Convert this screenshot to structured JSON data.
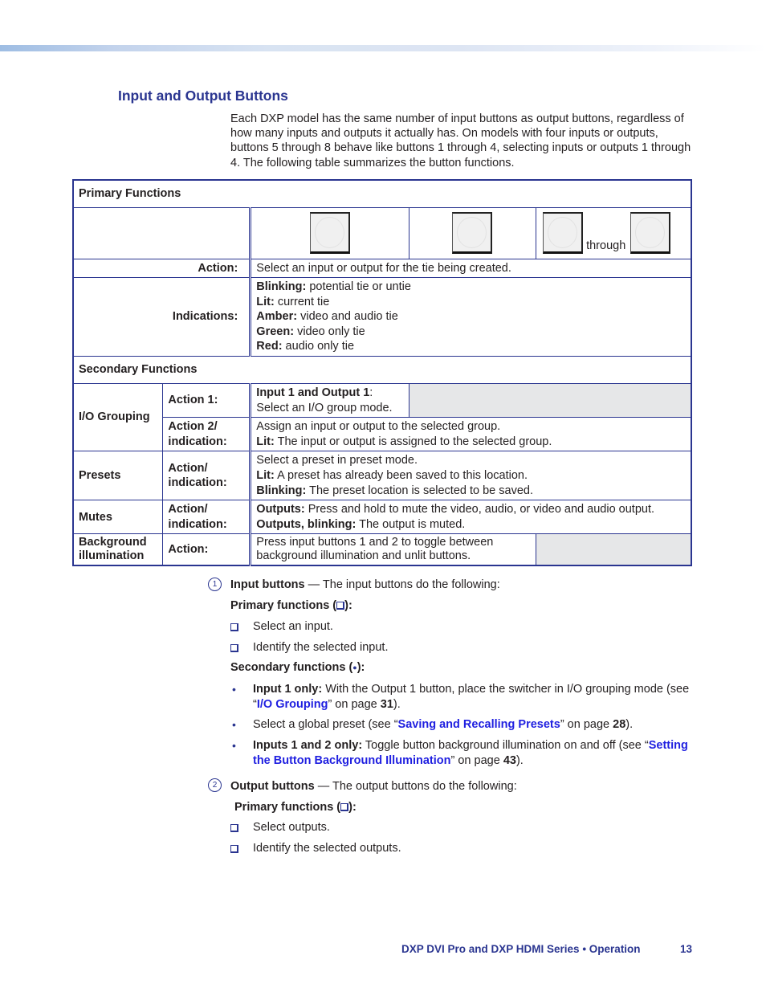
{
  "page": {
    "section_title": "Input and Output Buttons",
    "intro": "Each DXP model has the same number of input buttons as output buttons, regardless of how many inputs and outputs it actually has. On models with four inputs or outputs, buttons 5 through 8 behave like buttons 1 through 4, selecting inputs or outputs 1 through 4. The following table summarizes the button functions."
  },
  "table": {
    "primary_header": "Primary Functions",
    "through_label": "through",
    "action_label": "Action:",
    "action_text": "Select an input or output for the tie being created.",
    "indications_label": "Indications:",
    "indications": [
      {
        "term": "Blinking:",
        "desc": " potential tie or untie"
      },
      {
        "term": "Lit:",
        "desc": " current tie"
      },
      {
        "term": "Amber:",
        "desc": " video and audio tie"
      },
      {
        "term": "Green:",
        "desc": " video only tie"
      },
      {
        "term": "Red:",
        "desc": " audio only tie"
      }
    ],
    "secondary_header": "Secondary Functions",
    "io_grouping": {
      "label": "I/O Grouping",
      "action1_label": "Action 1:",
      "action1_term": "Input 1 and Output 1",
      "action1_colon": ":",
      "action1_desc": "Select an I/O group mode.",
      "action2_label_1": "Action 2/",
      "action2_label_2": "indication:",
      "action2_line1": "Assign an input or output to the selected group.",
      "action2_term": "Lit:",
      "action2_desc": " The input or output is assigned to the selected group."
    },
    "presets": {
      "label": "Presets",
      "action_label_1": "Action/",
      "action_label_2": "indication:",
      "line1": "Select a preset in preset mode.",
      "term2": "Lit:",
      "desc2": " A preset has already been saved to this location.",
      "term3": "Blinking:",
      "desc3": " The preset location is selected to be saved."
    },
    "mutes": {
      "label": "Mutes",
      "action_label_1": "Action/",
      "action_label_2": "indication:",
      "term1": "Outputs:",
      "desc1": " Press and hold to mute the video, audio, or video and audio output.",
      "term2": "Outputs, blinking:",
      "desc2": " The output is muted."
    },
    "background": {
      "label_1": "Background",
      "label_2": "illumination",
      "action_label": "Action:",
      "line1": "Press input buttons 1 and 2 to toggle between",
      "line2": "background illumination and unlit buttons."
    }
  },
  "input_section": {
    "callout": "1",
    "title": "Input buttons",
    "title_rest": " — The input buttons do the following:",
    "primary_label": "Primary functions (",
    "primary_label_end": "):",
    "primary_items": [
      "Select an input.",
      "Identify the selected input."
    ],
    "secondary_label": "Secondary functions (",
    "secondary_glyph": "●",
    "secondary_label_end": "):",
    "bullets": [
      {
        "lead": "Input 1 only:",
        "text": " With the Output 1 button, place the switcher in I/O grouping  mode (see “",
        "link": "I/O Grouping",
        "after": "” on page ",
        "page": "31",
        "end": ")."
      },
      {
        "lead": "",
        "text": "Select a global preset (see “",
        "link": "Saving and Recalling Presets",
        "after": "” on page ",
        "page": "28",
        "end": ")."
      },
      {
        "lead": "Inputs 1 and 2 only:",
        "text": " Toggle button background illumination on and off (see “",
        "link": "Setting the Button Background Illumination",
        "after": "” on page ",
        "page": "43",
        "end": ")."
      }
    ]
  },
  "output_section": {
    "callout": "2",
    "title": "Output buttons",
    "title_rest": " — The output buttons do the following:",
    "primary_label": "Primary functions (",
    "primary_label_end": "):",
    "primary_items": [
      "Select outputs.",
      "Identify the selected outputs."
    ]
  },
  "footer": {
    "title": "DXP DVI Pro and DXP HDMI Series • Operation",
    "page_number": "13"
  },
  "colors": {
    "heading_blue": "#2a3590",
    "link_blue": "#1f1fe0",
    "shade_gray": "#e6e7e8"
  }
}
